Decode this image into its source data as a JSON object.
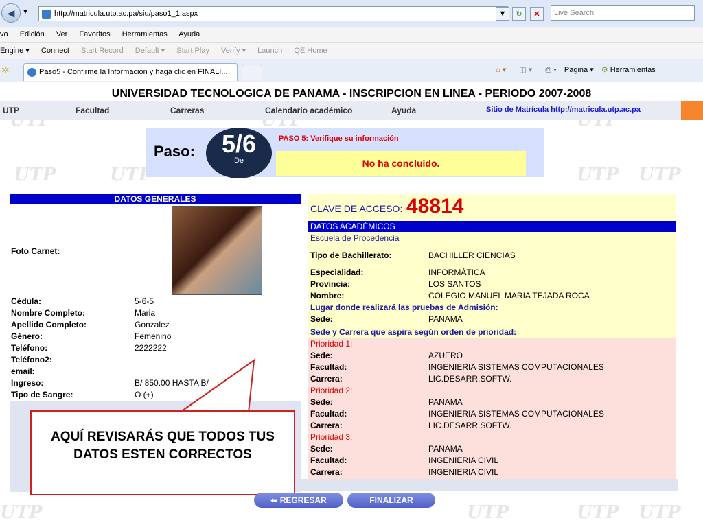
{
  "browser": {
    "url": "http://matricula.utp.ac.pa/siu/paso1_1.aspx",
    "search_placeholder": "Live Search",
    "menu": [
      "vo",
      "Edición",
      "Ver",
      "Favoritos",
      "Herramientas",
      "Ayuda"
    ],
    "toolbar": [
      "Engine ▾",
      "Connect",
      "Start Record",
      "Default ▾",
      "Start Play",
      "Verify ▾",
      "Launch",
      "QE Home"
    ],
    "tab_title": "Paso5 - Confirme la Información y haga clic en FINALI...",
    "right_tools": [
      "Página ▾",
      "Herramientas"
    ]
  },
  "header": {
    "title": "UNIVERSIDAD TECNOLOGICA DE PANAMA - INSCRIPCION EN LINEA - PERIODO 2007-2008",
    "nav": [
      "UTP",
      "Facultad",
      "Carreras",
      "Calendario académico",
      "Ayuda"
    ],
    "site_link": "Sitio de Matrícula http://matricula.utp.ac.pa"
  },
  "paso": {
    "label": "Paso:",
    "step": "5/6",
    "de": "De",
    "verify_text": "PASO 5: Verifique su información",
    "status": "No ha concluido."
  },
  "generales": {
    "title": "DATOS GENERALES",
    "photo_label": "Foto Carnet:",
    "fields": [
      {
        "label": "Cédula:",
        "value": "5-6-5"
      },
      {
        "label": "Nombre Completo:",
        "value": "Maria"
      },
      {
        "label": "Apellido Completo:",
        "value": "Gonzalez"
      },
      {
        "label": "Género:",
        "value": "Femenino"
      },
      {
        "label": "Teléfono:",
        "value": "2222222"
      },
      {
        "label": "Teléfono2:",
        "value": ""
      },
      {
        "label": "email:",
        "value": ""
      },
      {
        "label": "Ingreso:",
        "value": "B/ 850.00 HASTA B/"
      },
      {
        "label": "Tipo de Sangre:",
        "value": "O (+)"
      }
    ]
  },
  "academico": {
    "clave_label": "CLAVE DE ACCESO:",
    "clave_value": "48814",
    "title": "DATOS ACADÉMICOS",
    "escuela": "Escuela de Procedencia",
    "tipo_label": "Tipo de Bachillerato:",
    "tipo_value": "BACHILLER CIENCIAS",
    "esp_label": "Especialidad:",
    "esp_value": "INFORMÁTICA",
    "prov_label": "Provincia:",
    "prov_value": "LOS SANTOS",
    "nom_label": "Nombre:",
    "nom_value": "COLEGIO MANUEL MARIA TEJADA ROCA",
    "lugar": "Lugar donde realizará las pruebas de Admisión:",
    "sede_label": "Sede:",
    "sede_value": "PANAMA",
    "aspira": "Sede y Carrera que aspira según orden de prioridad:",
    "prioridades": [
      {
        "title": "Prioridad 1:",
        "sede": "AZUERO",
        "facultad": "INGENIERIA SISTEMAS COMPUTACIONALES",
        "carrera": "LIC.DESARR.SOFTW."
      },
      {
        "title": "Prioridad 2:",
        "sede": "PANAMA",
        "facultad": "INGENIERIA SISTEMAS COMPUTACIONALES",
        "carrera": "LIC.DESARR.SOFTW."
      },
      {
        "title": "Prioridad 3:",
        "sede": "PANAMA",
        "facultad": "INGENIERIA CIVIL",
        "carrera": "INGENIERIA CIVIL"
      }
    ],
    "sede_l": "Sede:",
    "fac_l": "Facultad:",
    "car_l": "Carrera:"
  },
  "callout": "AQUÍ REVISARÁS QUE TODOS TUS DATOS ESTEN CORRECTOS",
  "buttons": {
    "regresar": "REGRESAR",
    "finalizar": "FINALIZAR"
  }
}
